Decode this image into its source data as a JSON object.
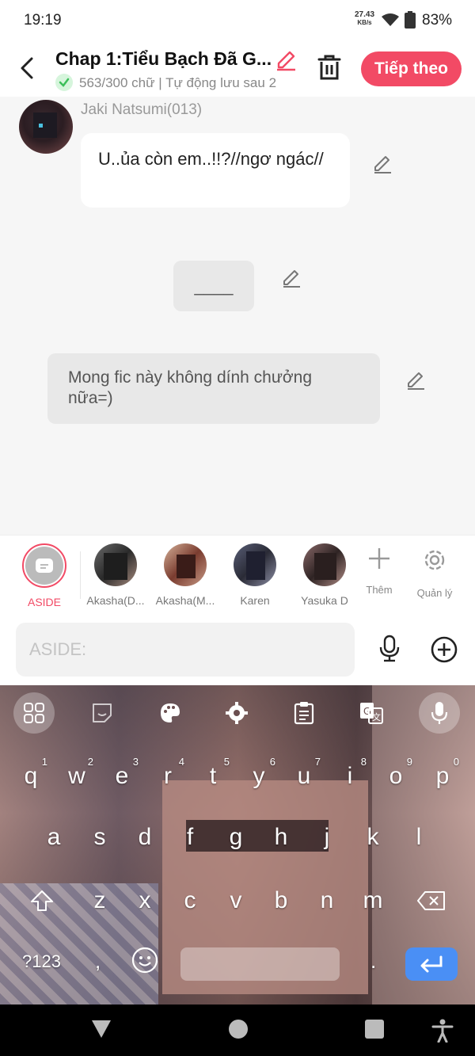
{
  "status_bar": {
    "time": "19:19",
    "network_speed": "27.43",
    "network_unit": "KB/s",
    "battery": "83%"
  },
  "header": {
    "title": "Chap 1:Tiểu Bạch Đã G...",
    "word_count": "563/300 chữ",
    "autosave_text": " | Tự động lưu sau 2",
    "next_label": "Tiếp theo"
  },
  "chat": {
    "speaker_name": "Jaki Natsumi(013)",
    "messages": [
      {
        "text": "U..ủa còn em..!!?//ngơ ngác//"
      },
      {
        "text": "____"
      },
      {
        "text": "Mong fic này không dính chưởng nữa=)"
      }
    ]
  },
  "characters": [
    {
      "name": "ASIDE",
      "selected": true
    },
    {
      "name": "Akasha(D..."
    },
    {
      "name": "Akasha(M..."
    },
    {
      "name": "Karen"
    },
    {
      "name": "Yasuka D"
    }
  ],
  "tools": {
    "add_label": "Thêm",
    "manage_label": "Quản lý"
  },
  "input": {
    "placeholder": "ASIDE:"
  },
  "keyboard": {
    "row1": [
      "q",
      "w",
      "e",
      "r",
      "t",
      "y",
      "u",
      "i",
      "o",
      "p"
    ],
    "row1_nums": [
      "1",
      "2",
      "3",
      "4",
      "5",
      "6",
      "7",
      "8",
      "9",
      "0"
    ],
    "row2": [
      "a",
      "s",
      "d",
      "f",
      "g",
      "h",
      "j",
      "k",
      "l"
    ],
    "row3": [
      "z",
      "x",
      "c",
      "v",
      "b",
      "n",
      "m"
    ],
    "sym_label": "?123",
    "comma": ",",
    "period": "."
  },
  "colors": {
    "accent": "#f24a65",
    "enter_key": "#4a8ff5"
  }
}
